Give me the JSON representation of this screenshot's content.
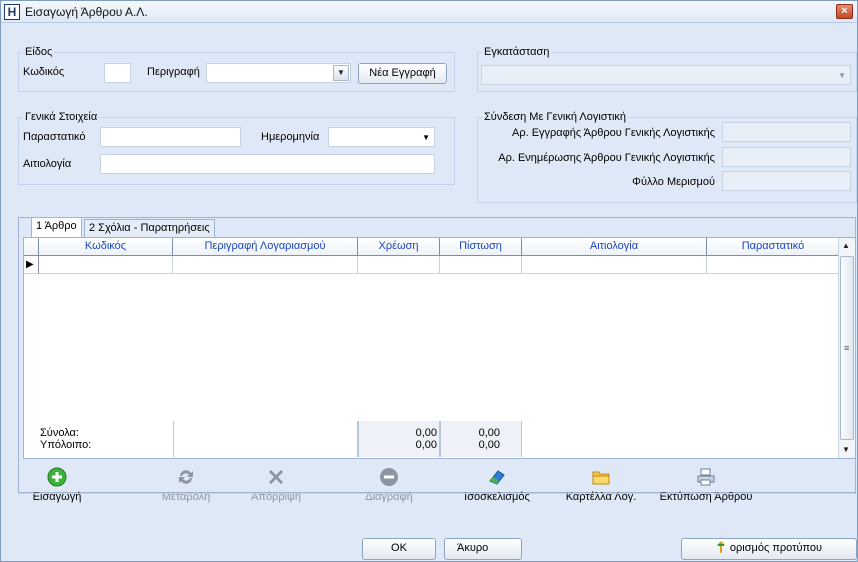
{
  "window": {
    "title": "Εισαγωγή Άρθρου Α.Λ.",
    "icon_letter": "H",
    "close_label": "×"
  },
  "eidos": {
    "group_title": "Είδος",
    "kodikos_label": "Κωδικός",
    "kodikos_value": "",
    "perigrafi_label": "Περιγραφή",
    "perigrafi_value": "",
    "new_button": "Νέα Εγγραφή"
  },
  "egkatastasi": {
    "group_title": "Εγκατάσταση",
    "value": ""
  },
  "genika": {
    "group_title": "Γενικά Στοιχεία",
    "parastatiko_label": "Παραστατικό",
    "parastatiko_value": "",
    "hmerominia_label": "Ημερομηνία",
    "hmerominia_value": "",
    "apologia_label": "Αιτιολογία",
    "apologia_value": ""
  },
  "syndesi": {
    "group_title": "Σύνδεση Με Γενική Λογιστική",
    "ar_eggrafis_label": "Αρ. Εγγραφής Άρθρου Γενικής Λογιστικής",
    "ar_enimerosis_label": "Αρ. Ενημέρωσης Άρθρου Γενικής Λογιστικής",
    "fyllo_label": "Φύλλο Μερισμού"
  },
  "tabs": [
    {
      "label": "1 Άρθρο",
      "active": true
    },
    {
      "label": "2 Σχόλια - Παρατηρήσεις",
      "active": false
    }
  ],
  "grid": {
    "columns": [
      "Κωδικός",
      "Περιγραφή Λογαριασμού",
      "Χρέωση",
      "Πίστωση",
      "Αιτιολογία",
      "Παραστατικό"
    ],
    "row_indicator": "▶",
    "totals_label": "Σύνολα:",
    "balance_label": "Υπόλοιπο:",
    "totals_debit": "0,00",
    "totals_credit": "0,00",
    "balance_debit": "0,00",
    "balance_credit": "0,00"
  },
  "toolbar": {
    "insert": "Εισαγωγή",
    "edit": "Μεταβολή",
    "reject": "Απόρριψη",
    "delete": "Διαγραφή",
    "balance": "Ισοσκελισμός",
    "ledger_card": "Καρτέλλα Λογ.",
    "print": "Εκτύπωση Άρθρου"
  },
  "footer": {
    "ok": "OK",
    "cancel": "Άκυρο",
    "template": "ορισμός προτύπου"
  }
}
